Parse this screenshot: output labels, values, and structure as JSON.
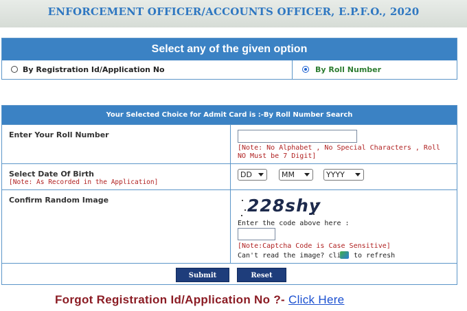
{
  "header": {
    "title": "ENFORCEMENT OFFICER/ACCOUNTS OFFICER, E.P.F.O., 2020"
  },
  "options": {
    "title": "Select any of the given option",
    "by_registration_label": "By Registration Id/Application No",
    "by_roll_label": "By Roll Number",
    "selected": "by_roll"
  },
  "form": {
    "title": "Your Selected Choice for Admit Card is :-By Roll Number Search",
    "roll_label": "Enter Your Roll Number",
    "roll_value": "",
    "roll_note": "[Note: No Alphabet , No Special Characters , Roll NO Must be 7 Digit]",
    "dob_label": "Select Date Of Birth",
    "dob_note": "[Note: As Recorded in the Application]",
    "dob_day": "DD",
    "dob_month": "MM",
    "dob_year": "YYYY",
    "captcha_label": "Confirm Random Image",
    "captcha_code": "228shy",
    "captcha_prompt": "Enter the code above here :",
    "captcha_value": "",
    "captcha_note": "[Note:Captcha Code is Case Sensitive]",
    "cant_read": "Can't read the image? click",
    "to_refresh": "to refresh"
  },
  "buttons": {
    "submit": "Submit",
    "reset": "Reset"
  },
  "footer": {
    "forgot_text": "Forgot Registration Id/Application No ?-",
    "click_here": "Click Here"
  },
  "icons": {
    "refresh": "refresh-icon"
  },
  "colors": {
    "accent": "#3b82c4",
    "note": "#b02020",
    "button": "#1e3d7b",
    "forgot": "#8b1c24",
    "link": "#1a4fd0"
  }
}
